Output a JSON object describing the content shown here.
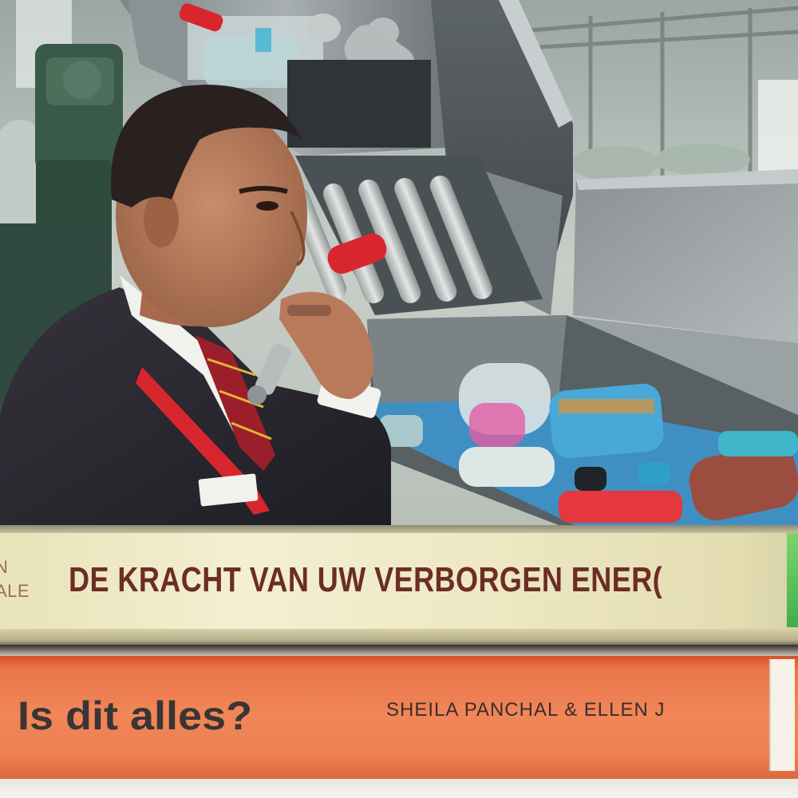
{
  "book_top": {
    "author_fragment_line1": "N",
    "author_fragment_line2": "ALE",
    "title": "DE KRACHT VAN UW VERBORGEN ENER("
  },
  "book_bottom": {
    "title": "Is dit alles?",
    "authors": "SHEILA PANCHAL & ELLEN J"
  },
  "colors": {
    "suit": "#2a2830",
    "lanyard": "#d8262e",
    "conveyor": "#3f8fc3",
    "book_top_text": "#6b2d25",
    "book_bottom_cover": "#ef7d50"
  }
}
